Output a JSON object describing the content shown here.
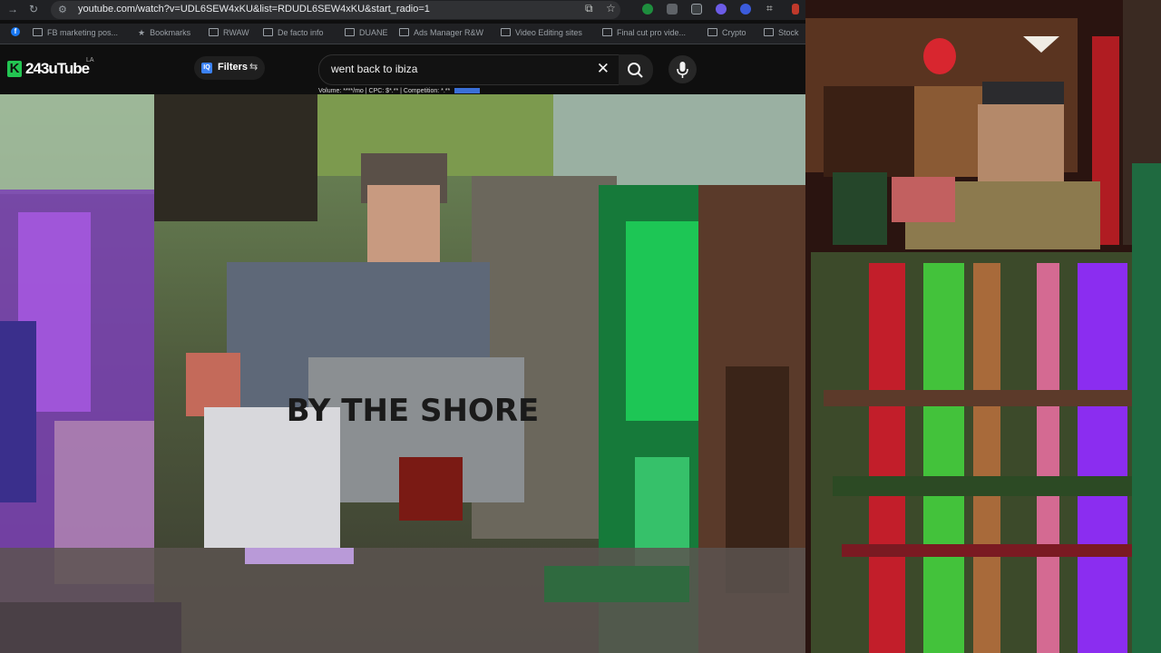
{
  "browser": {
    "url": "youtube.com/watch?v=UDL6SEW4xKU&list=RDUDL6SEW4xKU&start_radio=1",
    "bookmarks": [
      "FB marketing pos...",
      "Bookmarks",
      "RWAW",
      "De facto info",
      "DUANE",
      "Ads Manager R&W",
      "Video Editing sites",
      "Final cut pro vide...",
      "Crypto",
      "Stock"
    ]
  },
  "youtube": {
    "logo_text": "243uTube",
    "logo_badge": "K",
    "country": "LA",
    "filters_label": "Filters",
    "filters_badge": "IQ",
    "search_value": "went back to ibiza",
    "seo_stats": "Volume: ****/mo | CPC: $*.** | Competition: *.**"
  },
  "video": {
    "sign_text": "BY THE SHORE"
  },
  "colors": {
    "youtube_bg": "#0f0f0f",
    "chrome_bar": "#202124",
    "logo_green": "#23c552",
    "glitch_purple": "#9b3fd6",
    "glitch_green": "#1fd35a",
    "lantern_red": "#d8262f"
  }
}
